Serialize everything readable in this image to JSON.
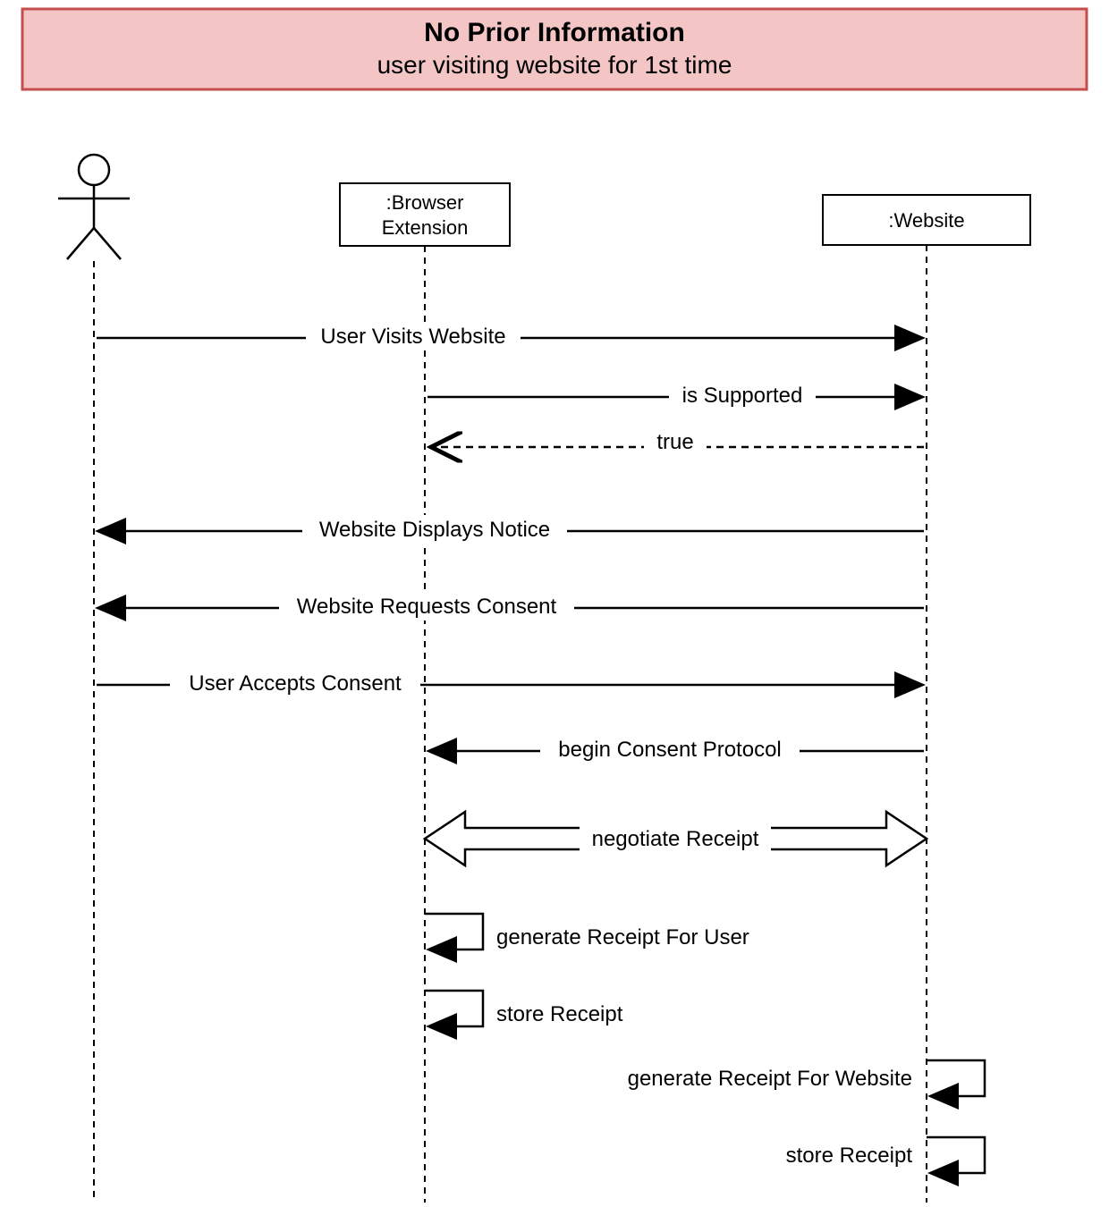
{
  "header": {
    "title": "No Prior Information",
    "subtitle": "user visiting website for 1st time"
  },
  "participants": {
    "browser_ext_l1": ":Browser",
    "browser_ext_l2": "Extension",
    "website": ":Website"
  },
  "messages": {
    "m1": "User Visits Website",
    "m2": "is Supported",
    "m3": "true",
    "m4": "Website Displays Notice",
    "m5": "Website  Requests Consent",
    "m6": "User Accepts Consent",
    "m7": "begin Consent Protocol",
    "m8": "negotiate Receipt",
    "m9": "generate Receipt For User",
    "m10": "store Receipt",
    "m11": "generate Receipt For Website",
    "m12": "store Receipt"
  },
  "colors": {
    "header_fill": "#f3c5c5",
    "header_stroke": "#c44d4d"
  }
}
